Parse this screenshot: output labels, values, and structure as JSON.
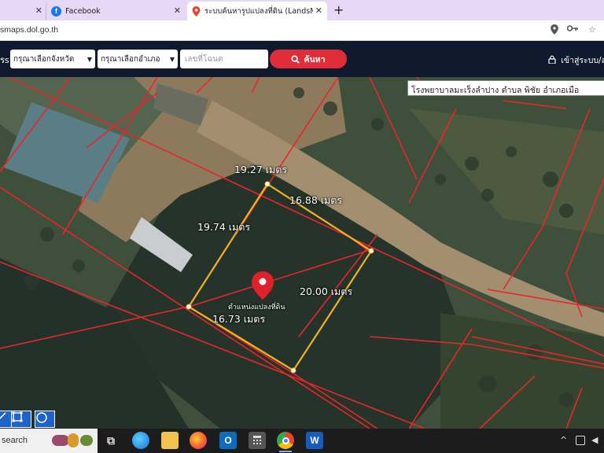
{
  "browser": {
    "tabs": [
      {
        "label": "",
        "has_close": true
      },
      {
        "label": "Facebook",
        "icon": "facebook-icon"
      },
      {
        "label": "ระบบค้นหารูปแปลงที่ดิน (LandsMaps",
        "icon": "map-pin-icon",
        "active": true
      }
    ],
    "url": "smaps.dol.go.th",
    "new_tab": "+"
  },
  "header": {
    "label": "รs",
    "province_select": "กรุณาเลือกจังหวัด",
    "amphoe_select": "กรุณาเลือกอำเภอ",
    "deed_placeholder": "เลขที่โฉนด",
    "search_button": "ค้นหา",
    "login": "เข้าสู่ระบบ/ล"
  },
  "map": {
    "info_box": "โรงพยาบาลมะเร็งลำปาง ตำบล พิชัย อำเภอเมือ",
    "plot_label": "ตำแหน่งแปลงที่ดิน",
    "dimensions": [
      "19.27 เมตร",
      "16.88 เมตร",
      "19.74 เมตร",
      "20.00 เมตร",
      "16.73 เมตร"
    ],
    "colors": {
      "parcel_line": "#e8262b",
      "plot_outline": "#f0b323",
      "pin": "#e0202a"
    }
  },
  "taskbar": {
    "search_text": "search",
    "icons": [
      "task-view-icon",
      "edge-icon",
      "file-explorer-icon",
      "firefox-icon",
      "outlook-icon",
      "calculator-icon",
      "chrome-icon",
      "word-icon"
    ],
    "tray": "^"
  }
}
